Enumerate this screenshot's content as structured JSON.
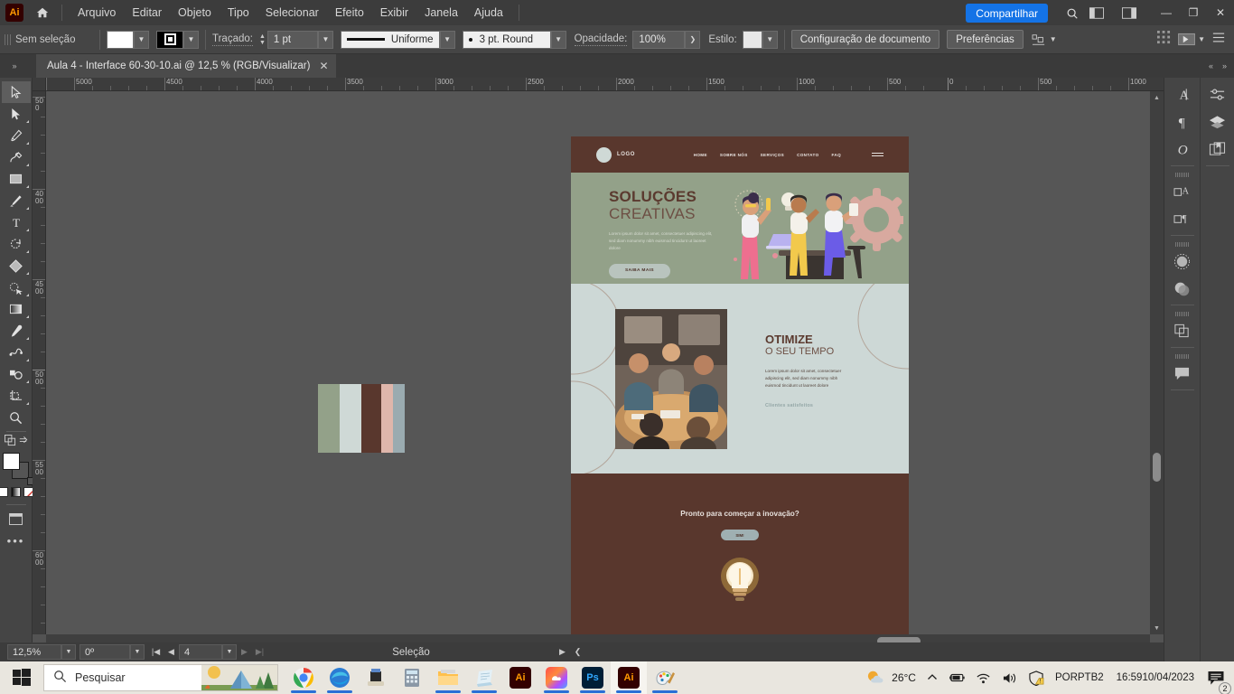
{
  "app": {
    "logo_text": "Ai",
    "menu_items": [
      "Arquivo",
      "Editar",
      "Objeto",
      "Tipo",
      "Selecionar",
      "Efeito",
      "Exibir",
      "Janela",
      "Ajuda"
    ],
    "share_label": "Compartilhar"
  },
  "control_bar": {
    "selection_status": "Sem seleção",
    "stroke_label": "Traçado:",
    "stroke_weight": "1 pt",
    "profile_label": "Uniforme",
    "brush_label": "3 pt. Round",
    "opacity_label": "Opacidade:",
    "opacity_value": "100%",
    "style_label": "Estilo:",
    "document_setup": "Configuração de documento",
    "preferences": "Preferências"
  },
  "document": {
    "tab_title": "Aula 4 - Interface 60-30-10.ai @ 12,5 % (RGB/Visualizar)",
    "close_glyph": "✕"
  },
  "rulers": {
    "horizontal": [
      "5000",
      "4500",
      "4000",
      "3500",
      "3000",
      "2500",
      "2000",
      "1500",
      "1000",
      "500",
      "0",
      "500",
      "1000"
    ],
    "vertical": [
      "500",
      "4000",
      "4500",
      "5000",
      "5500",
      "6000"
    ]
  },
  "tools": [
    {
      "name": "selection-tool",
      "glyph": "selection"
    },
    {
      "name": "direct-selection-tool",
      "glyph": "direct"
    },
    {
      "name": "pen-tool",
      "glyph": "pen"
    },
    {
      "name": "curvature-tool",
      "glyph": "curvature"
    },
    {
      "name": "rectangle-tool",
      "glyph": "rect"
    },
    {
      "name": "paintbrush-tool",
      "glyph": "brush"
    },
    {
      "name": "type-tool",
      "glyph": "type"
    },
    {
      "name": "rotate-tool",
      "glyph": "rotate"
    },
    {
      "name": "shape-builder-tool",
      "glyph": "shapebuilder"
    },
    {
      "name": "free-transform-tool",
      "glyph": "freetransform"
    },
    {
      "name": "gradient-tool",
      "glyph": "gradient"
    },
    {
      "name": "eyedropper-tool",
      "glyph": "eyedropper"
    },
    {
      "name": "blend-tool",
      "glyph": "blend"
    },
    {
      "name": "symbol-sprayer-tool",
      "glyph": "symbol"
    },
    {
      "name": "artboard-tool",
      "glyph": "artboard"
    },
    {
      "name": "zoom-tool",
      "glyph": "zoom"
    },
    {
      "name": "more-tools",
      "glyph": "ellipsis"
    }
  ],
  "artwork": {
    "swatches": [
      {
        "name": "sage-green",
        "hex": "#93a189",
        "width": 24
      },
      {
        "name": "light-gray",
        "hex": "#cfd9d6",
        "width": 24
      },
      {
        "name": "dark-brown",
        "hex": "#59372d",
        "width": 22
      },
      {
        "name": "dusty-pink",
        "hex": "#dfb6ab",
        "width": 13
      },
      {
        "name": "blue-gray",
        "hex": "#9aabb0",
        "width": 13
      }
    ]
  },
  "artboard": {
    "nav": {
      "logo": "LOGO",
      "links": [
        "HOME",
        "SOBRE NÓS",
        "SERVIÇOS",
        "CONTATO",
        "FAQ"
      ]
    },
    "hero": {
      "title_line1": "SOLUÇÕES",
      "title_line2": "CREATIVAS",
      "body": "Lorem ipsum dolor sit amet, consectetuer adipiscing elit, sed diam nonummy nibh euismod tincidunt ut laoreet dolore",
      "button": "SAIBA MAIS"
    },
    "section2": {
      "title_line1": "OTIMIZE",
      "title_line2": "O SEU TEMPO",
      "body": "Lorem ipsum dolor sit amet, consectetuer adipiscing elit, sed diam nonummy nibh euismod tincidunt ut laoreet dolore",
      "link": "Clientes satisfeitos"
    },
    "cta": {
      "title": "Pronto para começar a inovação?",
      "button": "SIM!"
    }
  },
  "status_bar": {
    "zoom": "12,5%",
    "rotation": "0º",
    "artboard_number": "4",
    "tool_name": "Seleção"
  },
  "right_panels": [
    {
      "name": "character-panel",
      "glyph": "A"
    },
    {
      "name": "paragraph-panel",
      "glyph": "¶"
    },
    {
      "name": "opentype-panel",
      "glyph": "O"
    },
    {
      "name": "align-panel",
      "glyph": "align"
    },
    {
      "name": "transform-panel",
      "glyph": "transform"
    },
    {
      "name": "appearance-panel",
      "glyph": "appearance"
    },
    {
      "name": "transparency-panel",
      "glyph": "transparency"
    },
    {
      "name": "pathfinder-panel",
      "glyph": "pathfinder"
    },
    {
      "name": "comments-panel",
      "glyph": "comment"
    }
  ],
  "right_panels2": [
    {
      "name": "properties-panel",
      "glyph": "properties"
    },
    {
      "name": "layers-panel",
      "glyph": "layers"
    },
    {
      "name": "libraries-panel",
      "glyph": "libraries"
    }
  ],
  "taskbar": {
    "search_placeholder": "Pesquisar",
    "apps": [
      {
        "name": "chrome",
        "label": ""
      },
      {
        "name": "edge",
        "label": ""
      },
      {
        "name": "scanner-app",
        "label": ""
      },
      {
        "name": "calculator",
        "label": ""
      },
      {
        "name": "file-explorer",
        "label": ""
      },
      {
        "name": "notepad",
        "label": ""
      },
      {
        "name": "illustrator-1",
        "label": "Ai"
      },
      {
        "name": "creative-cloud",
        "label": ""
      },
      {
        "name": "photoshop",
        "label": "Ps"
      },
      {
        "name": "illustrator-2",
        "label": "Ai"
      },
      {
        "name": "paint",
        "label": ""
      }
    ],
    "tray": {
      "temperature": "26°C",
      "language_line1": "POR",
      "language_line2": "PTB2",
      "time": "16:59",
      "date": "10/04/2023",
      "notification_count": "2"
    }
  }
}
